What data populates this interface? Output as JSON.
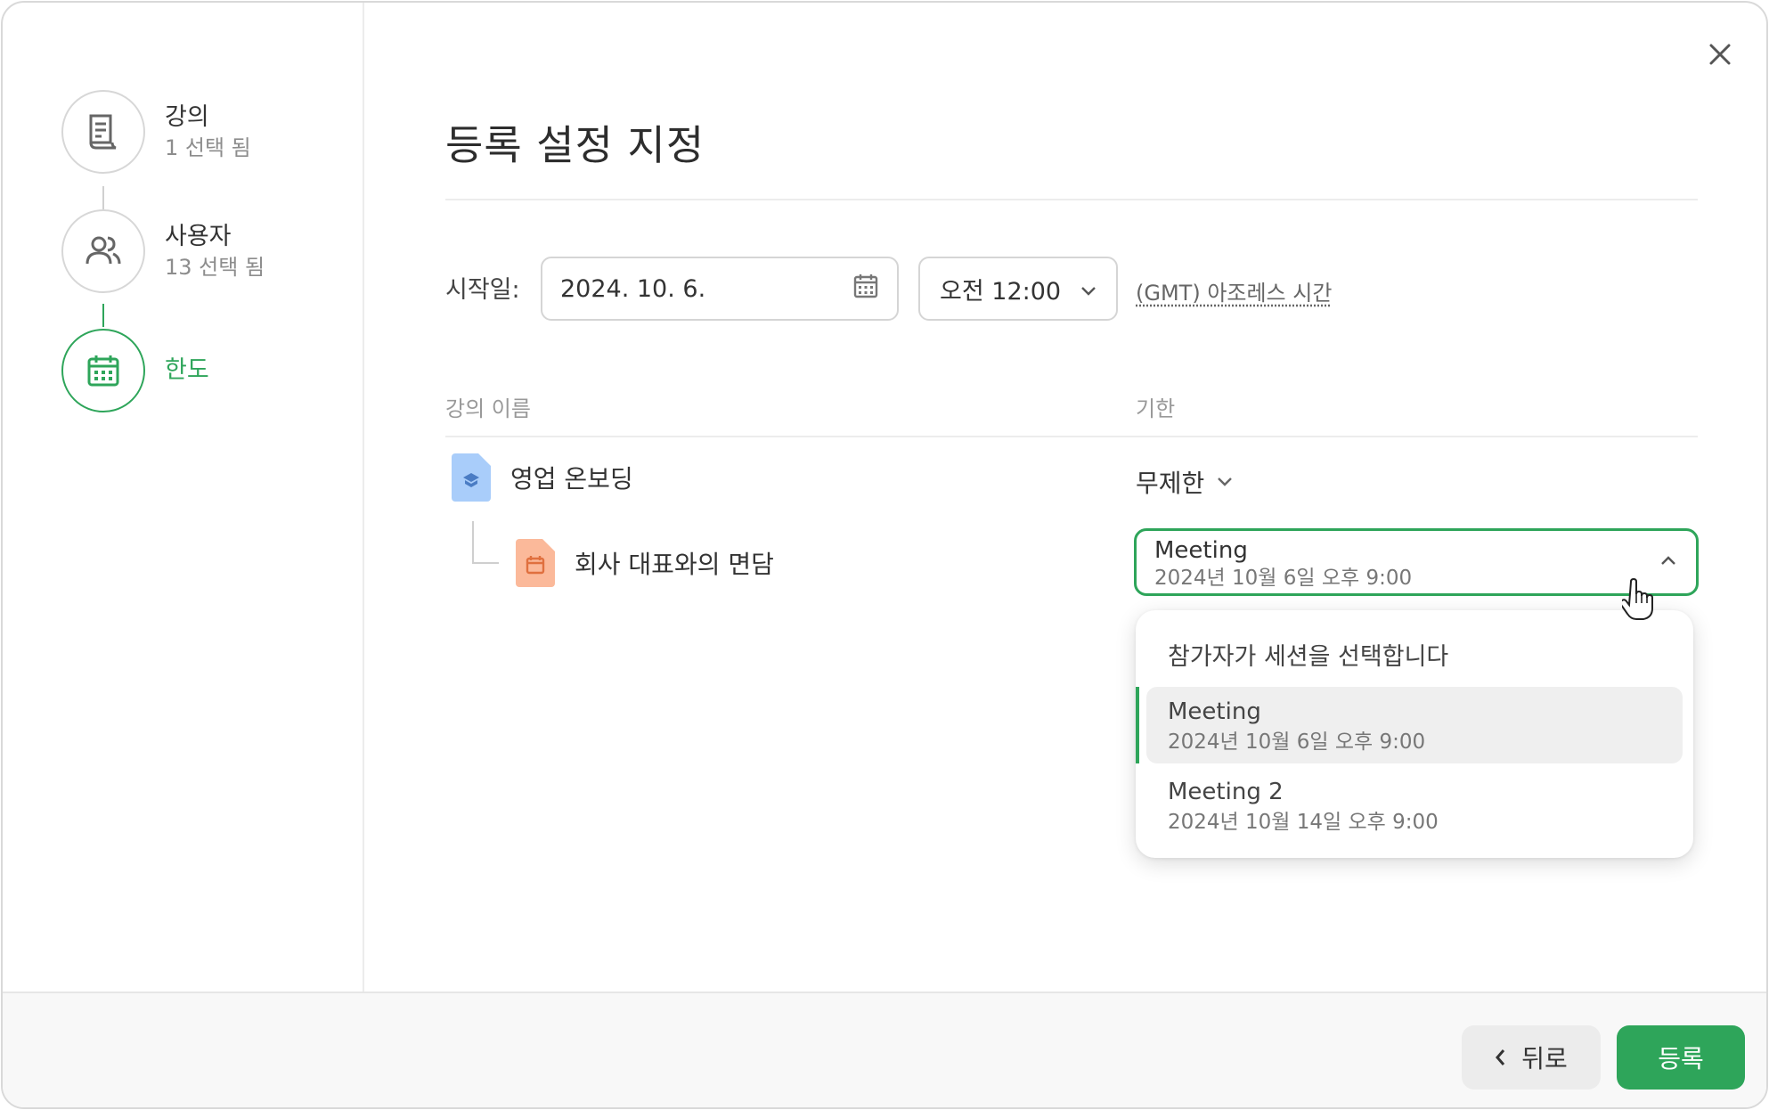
{
  "sidebar": {
    "steps": [
      {
        "title": "강의",
        "subtitle": "1 선택 됨",
        "icon": "document-icon"
      },
      {
        "title": "사용자",
        "subtitle": "13 선택 됨",
        "icon": "users-icon"
      },
      {
        "title": "한도",
        "subtitle": "",
        "icon": "calendar-icon"
      }
    ]
  },
  "main": {
    "title": "등록 설정 지정",
    "start_label": "시작일:",
    "date_value": "2024. 10. 6.",
    "time_value": "오전 12:00",
    "timezone": "(GMT) 아조레스 시간",
    "columns": {
      "course": "강의 이름",
      "deadline": "기한"
    },
    "course": {
      "name": "영업 온보딩",
      "deadline": "무제한"
    },
    "sub_item": {
      "name": "회사 대표와의 면담"
    },
    "session_select": {
      "name": "Meeting",
      "date": "2024년 10월 6일 오후 9:00"
    },
    "dropdown": {
      "header": "참가자가 세션을 선택합니다",
      "options": [
        {
          "name": "Meeting",
          "date": "2024년 10월 6일 오후 9:00",
          "selected": true
        },
        {
          "name": "Meeting 2",
          "date": "2024년 10월 14일 오후 9:00",
          "selected": false
        }
      ]
    }
  },
  "footer": {
    "back_label": "뒤로",
    "submit_label": "등록"
  },
  "colors": {
    "accent": "#2ea55a",
    "course_icon": "#a9cdfa",
    "session_icon": "#fbb99a"
  }
}
